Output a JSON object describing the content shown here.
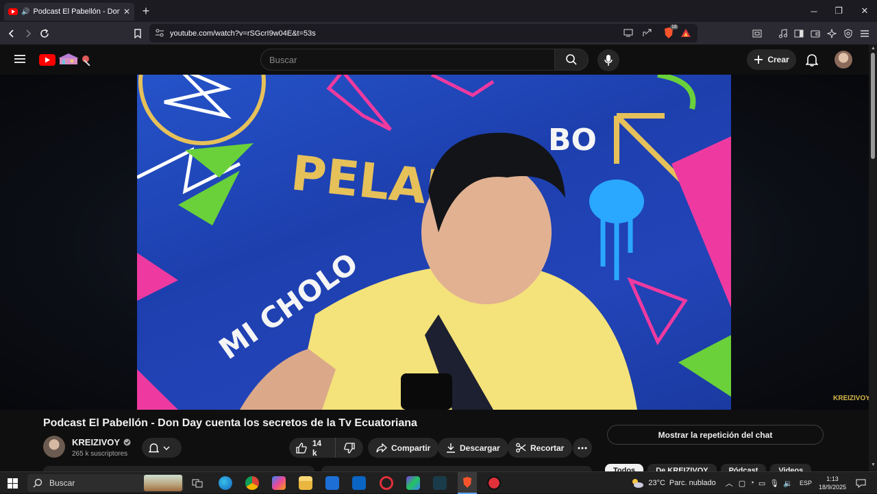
{
  "browser": {
    "tab_title": "Podcast El Pabellón - Don Day",
    "url": "youtube.com/watch?v=rSGcrI9w04E&t=53s",
    "extension_badge": "18"
  },
  "youtube": {
    "search_placeholder": "Buscar",
    "create_label": "Crear"
  },
  "video": {
    "title": "Podcast El Pabellón - Don Day cuenta los secretos de la Tv Ecuatoriana",
    "watermark": "KREIZIVOY",
    "graffiti_1": "PELAU",
    "graffiti_2": "MI CHOLO",
    "graffiti_3": "BO"
  },
  "channel": {
    "name": "KREIZIVOY",
    "subscribers": "265 k suscriptores"
  },
  "actions": {
    "likes": "14 k",
    "share": "Compartir",
    "download": "Descargar",
    "clip": "Recortar"
  },
  "chat": {
    "replay_label": "Mostrar la repetición del chat"
  },
  "chips": [
    "Todos",
    "De KREIZIVOY",
    "Pódcast",
    "Videos"
  ],
  "taskbar": {
    "search_label": "Buscar",
    "temperature": "23°C",
    "weather": "Parc. nublado",
    "language": "ESP",
    "time": "1:13",
    "date": "18/9/2025"
  }
}
